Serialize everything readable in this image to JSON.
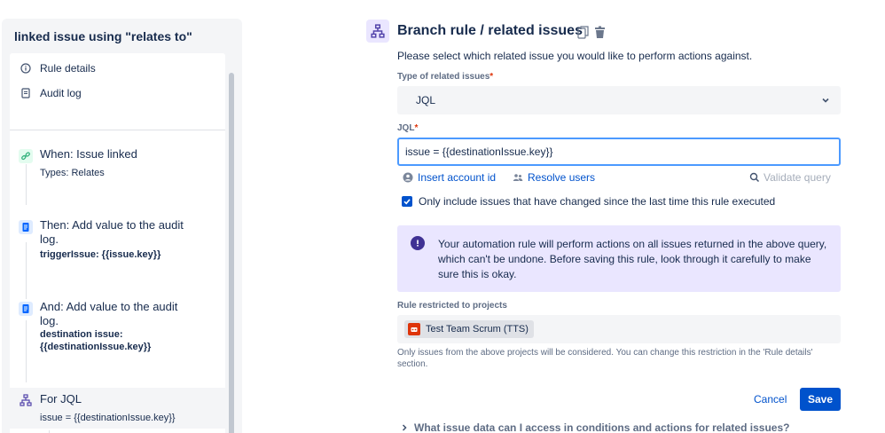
{
  "sidebar": {
    "title": "linked issue using \"relates to\"",
    "meta_items": [
      {
        "label": "Rule details",
        "icon": "info-icon"
      },
      {
        "label": "Audit log",
        "icon": "document-icon"
      }
    ],
    "steps": [
      {
        "title": "When: Issue linked",
        "detail": "Types: Relates",
        "icon": "link-icon",
        "color": "#36b37e"
      },
      {
        "title": "Then: Add value to the audit log.",
        "detail": "triggerIssue: {{issue.key}}",
        "icon": "document-icon",
        "color": "#0065ff"
      },
      {
        "title": "And: Add value to the audit log.",
        "detail": "destination issue: {{destinationIssue.key}}",
        "icon": "document-icon",
        "color": "#0065ff"
      },
      {
        "title": "For JQL",
        "detail": "issue = {{destinationIssue.key}}",
        "icon": "branch-icon",
        "color": "#5243aa"
      }
    ]
  },
  "main": {
    "title": "Branch rule / related issues",
    "instructions": "Please select which related issue you would like to perform actions against.",
    "type_label": "Type of related issues",
    "type_value": "JQL",
    "jql_label": "JQL",
    "jql_value": "issue = {{destinationIssue.key}}",
    "insert_account_label": "Insert account id",
    "resolve_users_label": "Resolve users",
    "validate_label": "Validate query",
    "checkbox_label": "Only include issues that have changed since the last time this rule executed",
    "checkbox_checked": true,
    "warning_text": "Your automation rule will perform actions on all issues returned in the above query, which can't be undone. Before saving this rule, look through it carefully to make sure this is okay.",
    "projects_label": "Rule restricted to projects",
    "project_tag": "Test Team Scrum (TTS)",
    "help_text": "Only issues from the above projects will be considered. You can change this restriction in the 'Rule details' section.",
    "cancel_label": "Cancel",
    "save_label": "Save",
    "faq_label": "What issue data can I access in conditions and actions for related issues?"
  },
  "colors": {
    "accent": "#0052cc",
    "focus": "#4c9aff",
    "warning_bg": "#eae6ff",
    "required": "#de350b"
  }
}
